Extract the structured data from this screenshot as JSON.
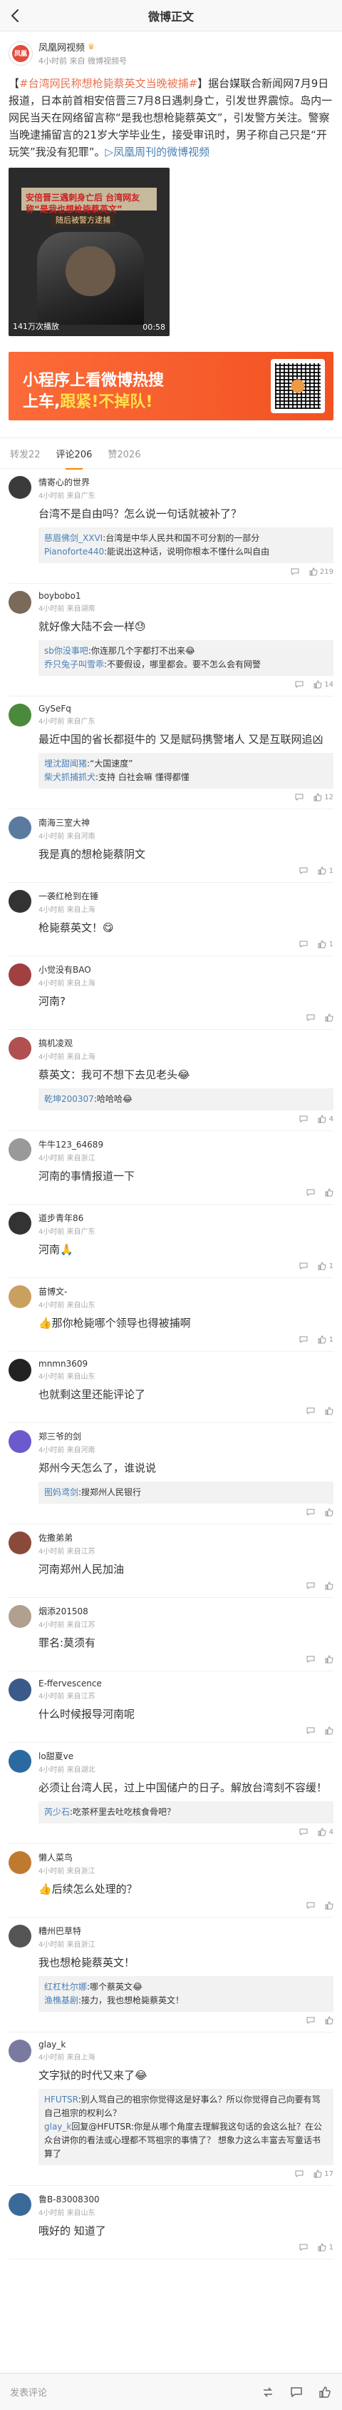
{
  "header": {
    "title": "微博正文"
  },
  "post": {
    "author": "凤凰网视频",
    "author_badge": "crown",
    "sub": "4小时前 来自 微博视频号",
    "topic": "#台湾网民称想枪毙蔡英文当晚被捕#",
    "body": "据台媒联合新闻网7月9日报道，日本前首相安倍晋三7月8日遇刺身亡，引发世界震惊。岛内一网民当天在网络留言称“是我也想枪毙蔡英文”，引发警方关注。警察当晚逮捕留言的21岁大学毕业生，接受审讯时，男子称自己只是“开玩笑”我没有犯罪”。",
    "link": "凤凰周刊的微博视频",
    "video": {
      "caption": "安倍晋三遇刺身亡后 台湾网友称“是我也想枪毙蔡英文”",
      "tag": "随后被警方逮捕",
      "stats": "141万次播放",
      "duration": "00:58"
    }
  },
  "banner": {
    "line1": "小程序上看微博热搜",
    "line2_a": "上车,",
    "line2_b": "跟紧!不掉队!",
    "accent": "#f35222"
  },
  "tabs": [
    {
      "label": "转发22"
    },
    {
      "label": "评论206"
    },
    {
      "label": "赞2026"
    }
  ],
  "comments": [
    {
      "name": "情寄心的世界",
      "meta": "4小时前 来自广东",
      "avatar": "#3b3b3b",
      "text": "台湾不是自由吗？怎么说一句话就被补了？",
      "replies": [
        {
          "name": "慈眉佛剑_XXVI",
          "text": ":台湾是中华人民共和国不可分割的一部分"
        },
        {
          "name": "Pianoforte440",
          "text": ":能说出这种话，说明你根本不懂什么叫自由"
        }
      ],
      "likes": "219"
    },
    {
      "name": "boybobo1",
      "meta": "4小时前 来自湖南",
      "avatar": "#7a6a5a",
      "text": "就好像大陆不会一样😓",
      "replies": [
        {
          "name": "sb你没事吧",
          "text": ":你连那几个字都打不出来😂"
        },
        {
          "name": "乔只兔子叫雪乖",
          "text": ":不要假设，哪里都会。要不怎么会有网警"
        }
      ],
      "likes": "14"
    },
    {
      "name": "GySeFq",
      "meta": "4小时前 来自广东",
      "avatar": "#4a8a3a",
      "text": "最近中国的省长都挺牛的 又是赋码携警堵人 又是互联网追凶",
      "replies": [
        {
          "name": "埋沈甜闻猪",
          "text": ":“大国速度”"
        },
        {
          "name": "柴犬抓捕抓犬",
          "text": ":支持 白社会嘛 懂得都懂"
        }
      ],
      "likes": "12"
    },
    {
      "name": "南海三室大神",
      "meta": "4小时前 来自河南",
      "avatar": "#5a7aa0",
      "text": "我是真的想枪毙蔡阴文",
      "replies": [],
      "likes": "1"
    },
    {
      "name": "一袭红枪到在锤",
      "meta": "4小时前 来自上海",
      "avatar": "#333333",
      "text": "枪毙蔡英文！😋",
      "replies": [],
      "likes": "1"
    },
    {
      "name": "小觉没有BAO",
      "meta": "4小时前 来自上海",
      "avatar": "#a04040",
      "text": "河南?",
      "replies": [],
      "likes": ""
    },
    {
      "name": "搞机凌观",
      "meta": "4小时前 来自上海",
      "avatar": "#b05050",
      "text": "蔡英文：我可不想下去见老头😂",
      "replies": [
        {
          "name": "乾坤200307",
          "text": ":哈哈哈😂"
        }
      ],
      "likes": "4"
    },
    {
      "name": "牛牛123_64689",
      "meta": "4小时前 来自浙江",
      "avatar": "#999999",
      "text": "河南的事情报道一下",
      "replies": [],
      "likes": ""
    },
    {
      "name": "道步青年86",
      "meta": "4小时前 来自广东",
      "avatar": "#333333",
      "text": "河南🙏",
      "replies": [],
      "likes": "1"
    },
    {
      "name": "苗博文-",
      "meta": "4小时前 来自山东",
      "avatar": "#caa060",
      "text": "👍那你枪毙哪个领导也得被捕啊",
      "replies": [],
      "likes": "1"
    },
    {
      "name": "mnmn3609",
      "meta": "4小时前 来自山东",
      "avatar": "#222222",
      "text": "也就剩这里还能评论了",
      "replies": [],
      "likes": ""
    },
    {
      "name": "郑三爷的剑",
      "meta": "4小时前 来自河南",
      "avatar": "#6a5acd",
      "text": "郑州今天怎么了，谁说说",
      "replies": [
        {
          "name": "图妈鸢剑",
          "text": ":搜郑州人民银行"
        }
      ],
      "likes": ""
    },
    {
      "name": "佐撒弟弟",
      "meta": "4小时前 来自江苏",
      "avatar": "#8a4a3a",
      "text": "河南郑州人民加油",
      "replies": [],
      "likes": ""
    },
    {
      "name": "烟添201508",
      "meta": "4小时前 来自江苏",
      "avatar": "#b0a090",
      "text": "罪名:莫须有",
      "replies": [],
      "likes": ""
    },
    {
      "name": "E-ffervescence",
      "meta": "4小时前 来自江苏",
      "avatar": "#3a5a8a",
      "text": "什么时候报导河南呢",
      "replies": [],
      "likes": ""
    },
    {
      "name": "lo甜夏ve",
      "meta": "4小时前 来自湖北",
      "avatar": "#2a6aa0",
      "text": "必须让台湾人民，过上中国储户的日子。解放台湾刻不容缓！",
      "replies": [
        {
          "name": "芮少石",
          "text": ":吃茶杯里去吐吃核食骨吧？"
        }
      ],
      "likes": "4"
    },
    {
      "name": "懒人菜鸟",
      "meta": "4小时前 来自浙江",
      "avatar": "#c07a30",
      "text": "👍后续怎么处理的？",
      "replies": [],
      "likes": ""
    },
    {
      "name": "糟州巴草特",
      "meta": "4小时前 来自浙江",
      "avatar": "#555555",
      "text": "我也想枪毙蔡英文！",
      "replies": [
        {
          "name": "红杠杜尔娜",
          "text": ":哪个蔡英文😂"
        },
        {
          "name": "渔樵基剧",
          "text": ":接力，我也想枪毙蔡英文！"
        }
      ],
      "likes": ""
    },
    {
      "name": "glay_k",
      "meta": "4小时前 来自上海",
      "avatar": "#7a7aa0",
      "text": "文字狱的时代又来了😂",
      "replies": [
        {
          "name": "HFUTSR",
          "text": ":别人骂自己的祖宗你觉得这是好事么？所以你觉得自己向要有骂自己祖宗的权利么？"
        },
        {
          "name": "glay_k",
          "text": "回复@HFUTSR:你是从哪个角度去理解我这句话的会这么扯？在公众台讲你的看法或心理都不骂祖宗的事情了？ 想象力这么丰富去写童话书算了"
        }
      ],
      "likes": "17"
    },
    {
      "name": "鲁B-83008300",
      "meta": "4小时前 来自山东",
      "avatar": "#3a6a9a",
      "text": "哦好的 知道了",
      "replies": [],
      "likes": "1"
    }
  ],
  "bottom": {
    "publish": "发表评论"
  }
}
